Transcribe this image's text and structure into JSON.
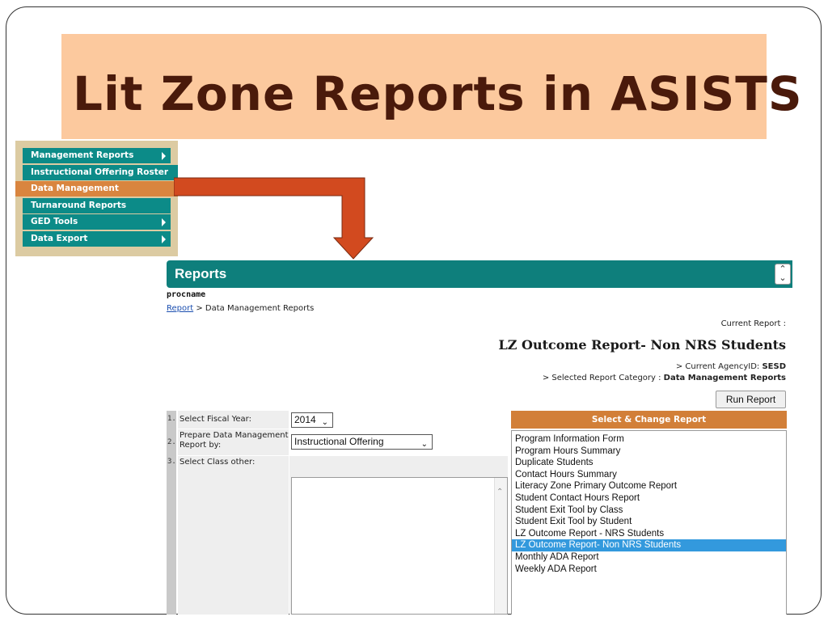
{
  "slide": {
    "title": "Lit Zone Reports in ASISTS"
  },
  "menu": {
    "items": [
      {
        "label": "Management Reports"
      },
      {
        "label": "Instructional Offering Roster"
      },
      {
        "label": "Data Management"
      },
      {
        "label": "Turnaround Reports"
      },
      {
        "label": "GED Tools"
      },
      {
        "label": "Data Export"
      }
    ]
  },
  "reports": {
    "header_title": "Reports",
    "scroll_glyph_up": "⌃",
    "scroll_glyph_down": "⌄",
    "procname": "procname",
    "breadcrumb_link": "Report",
    "breadcrumb_rest": " > Data Management Reports",
    "current_report_label": "Current Report :",
    "current_report_name": "LZ Outcome Report- Non NRS Students",
    "agency_prefix": "> Current AgencyID: ",
    "agency_id": "SESD",
    "category_prefix": "> Selected Report Category : ",
    "category": "Data Management Reports",
    "run_button": "Run Report"
  },
  "form": {
    "rows": [
      {
        "num": "1.",
        "label": "Select Fiscal Year:"
      },
      {
        "num": "2.",
        "label": "Prepare Data Management Report by:"
      },
      {
        "num": "3.",
        "label": "Select Class other:"
      }
    ],
    "fiscal_year": "2014",
    "prepare_by": "Instructional Offering"
  },
  "select_change": {
    "header": "Select & Change Report",
    "items": [
      {
        "label": "Program Information Form"
      },
      {
        "label": "Program Hours Summary"
      },
      {
        "label": "Duplicate Students"
      },
      {
        "label": "Contact Hours Summary"
      },
      {
        "label": "Literacy Zone Primary Outcome Report"
      },
      {
        "label": "Student Contact Hours Report"
      },
      {
        "label": "Student Exit Tool by Class"
      },
      {
        "label": "Student Exit Tool by Student"
      },
      {
        "label": "LZ Outcome Report - NRS Students"
      },
      {
        "label": "LZ Outcome Report- Non NRS Students"
      },
      {
        "label": "Monthly ADA Report"
      },
      {
        "label": "Weekly ADA Report"
      }
    ],
    "selected_index": 9
  },
  "colors": {
    "teal": "#0e7f7c",
    "orange": "#d27f38",
    "title_bg": "#fcc99e",
    "title_text": "#4a1a0b",
    "arrow": "#d24a1f",
    "selection": "#3399dd"
  }
}
